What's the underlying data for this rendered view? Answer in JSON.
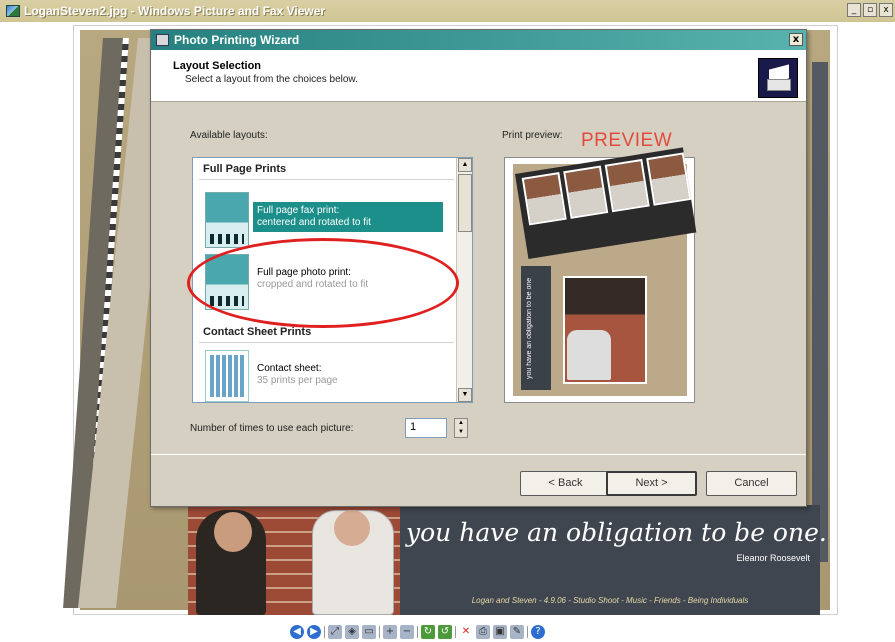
{
  "viewer": {
    "title": "LoganSteven2.jpg - Windows Picture and Fax Viewer",
    "controls": [
      "_",
      "▫",
      "x"
    ]
  },
  "collage": {
    "quote": "you have an obligation to be one.",
    "author": "Eleanor Roosevelt",
    "caption": "Logan and Steven - 4.9.06 - Studio Shoot - Music - Friends - Being Individuals"
  },
  "wizard": {
    "title": "Photo Printing Wizard",
    "close": "x",
    "heading": "Layout Selection",
    "subheading": "Select a layout from the choices below.",
    "available_label": "Available layouts:",
    "preview_label": "Print preview:",
    "preview_annotation": "PREVIEW",
    "groups": [
      {
        "name": "Full Page Prints"
      },
      {
        "name": "Contact Sheet Prints"
      }
    ],
    "items": [
      {
        "title": "Full page fax print:",
        "subtitle": "centered and rotated to fit",
        "selected": true
      },
      {
        "title": "Full page photo print:",
        "subtitle": "cropped and rotated to fit",
        "selected": false
      },
      {
        "title": "Contact sheet:",
        "subtitle": "35 prints per page",
        "selected": false
      }
    ],
    "preview_vertical_text": "you have an obligation to be one",
    "copies_label": "Number of times to use each picture:",
    "copies_value": "1",
    "buttons": {
      "back": "< Back",
      "next": "Next >",
      "cancel": "Cancel"
    }
  },
  "toolbar": {
    "icons": [
      "previous-icon",
      "next-icon",
      "best-fit-icon",
      "actual-size-icon",
      "slideshow-icon",
      "zoom-in-icon",
      "zoom-out-icon",
      "rotate-clockwise-icon",
      "rotate-counterclockwise-icon",
      "delete-icon",
      "print-icon",
      "save-icon",
      "edit-icon",
      "help-icon"
    ]
  },
  "colors": {
    "wizard_title": "#25807f",
    "selection": "#1c8f8a",
    "annotation_red": "#e01f1f",
    "dialog_bg": "#d6d0c2"
  }
}
